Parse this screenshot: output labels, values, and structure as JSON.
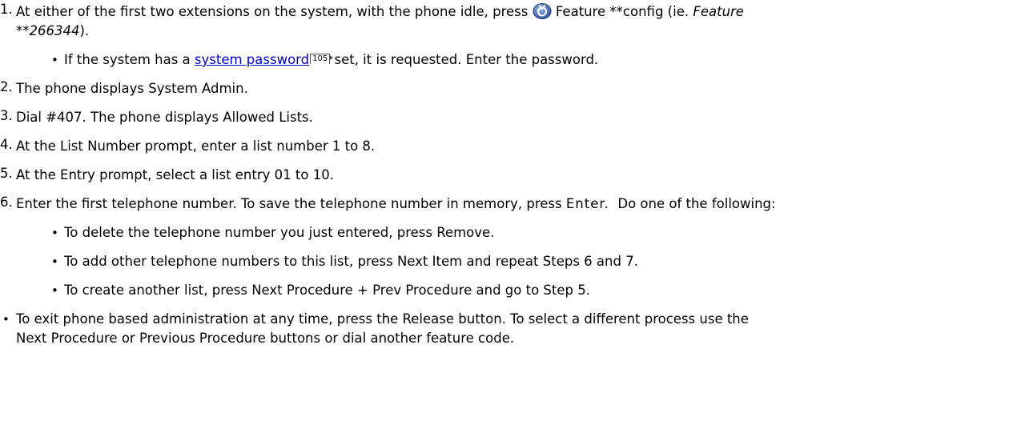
{
  "step1": {
    "num": "1.",
    "pre": "At either of the first two extensions on the system, with the phone idle, press ",
    "icon": "feature-icon",
    "post": " Feature **config (ie. ",
    "example_line1": "Feature",
    "example_line2": "**266344",
    "close": ").",
    "bullet_pre": "If the system has a ",
    "bullet_link": "system password",
    "bullet_ref": "105",
    "bullet_post": " set, it is requested. Enter the password."
  },
  "step2": {
    "num": "2.",
    "text": "The phone displays System Admin."
  },
  "step3": {
    "num": "3.",
    "text": "Dial #407. The phone displays Allowed Lists."
  },
  "step4": {
    "num": "4.",
    "text": "At the List Number prompt, enter a list number 1 to 8."
  },
  "step5": {
    "num": "5.",
    "text": "At the Entry prompt, select a list entry 01 to 10."
  },
  "step6": {
    "num": "6.",
    "pre": "Enter the first telephone number. To save the telephone number in memory, press ",
    "key": "Enter.",
    "post": "  Do one of the following:",
    "bullets": [
      "To delete the telephone number you just entered, press Remove.",
      "To add other telephone numbers to this list, press Next Item and repeat Steps 6 and 7.",
      "To create another list, press Next Procedure + Prev Procedure and go to Step 5."
    ]
  },
  "note": {
    "line1": "To exit phone based administration at any time, press the Release button. To select a different process use the",
    "line2": "Next Procedure or Previous Procedure buttons or dial another feature code."
  }
}
